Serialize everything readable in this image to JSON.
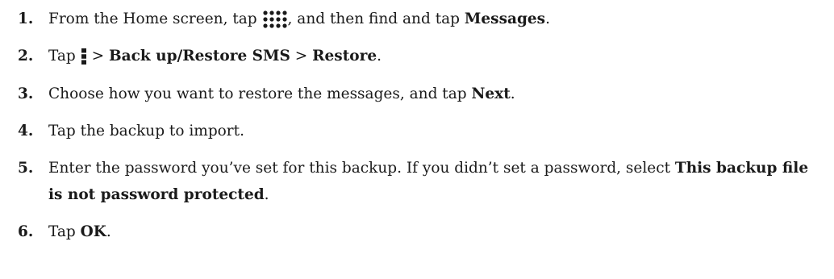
{
  "steps": [
    {
      "number": "1.",
      "parts": {
        "p1": "From the Home screen, tap",
        "icon": "apps-grid-icon",
        "p2": ", and then find and tap",
        "b1": "Messages",
        "p3": "."
      }
    },
    {
      "number": "2.",
      "parts": {
        "p1": "Tap",
        "icon": "more-vertical-icon",
        "sep1": ">",
        "b1": "Back up/Restore SMS",
        "sep2": ">",
        "b2": "Restore",
        "p2": "."
      }
    },
    {
      "number": "3.",
      "parts": {
        "p1": "Choose how you want to restore the messages, and tap",
        "b1": "Next",
        "p2": "."
      }
    },
    {
      "number": "4.",
      "parts": {
        "p1": "Tap the backup to import."
      }
    },
    {
      "number": "5.",
      "parts": {
        "p1": "Enter the password you’ve set for this backup. If you didn’t set a password, select",
        "b1": "This backup file is not password protected",
        "p2": "."
      }
    },
    {
      "number": "6.",
      "parts": {
        "p1": "Tap",
        "b1": "OK",
        "p2": "."
      }
    }
  ]
}
